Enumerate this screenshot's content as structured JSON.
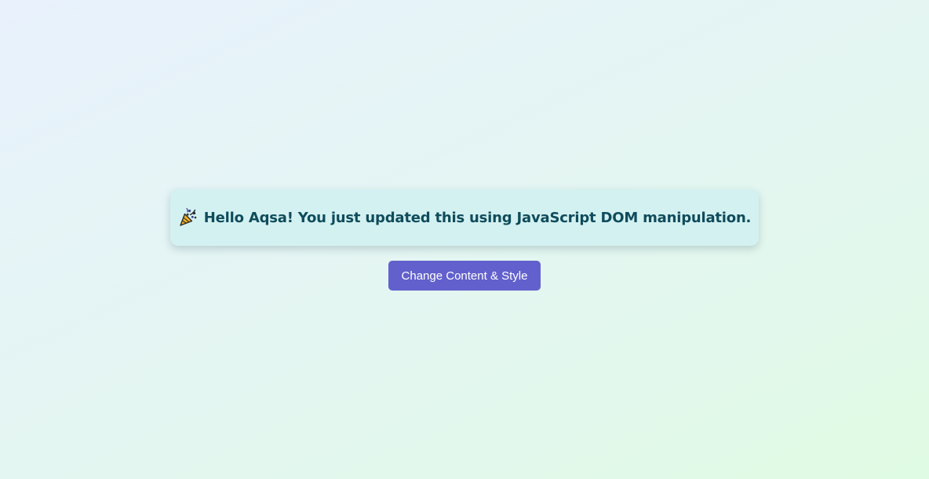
{
  "message": {
    "icon": "party-popper-icon",
    "text": "Hello Aqsa! You just updated this using JavaScript DOM manipulation.",
    "text_color": "#0f4c5c",
    "background_color": "#d4f1f1"
  },
  "button": {
    "label": "Change Content & Style",
    "background_color": "#6260cc",
    "text_color": "#ffffff"
  }
}
